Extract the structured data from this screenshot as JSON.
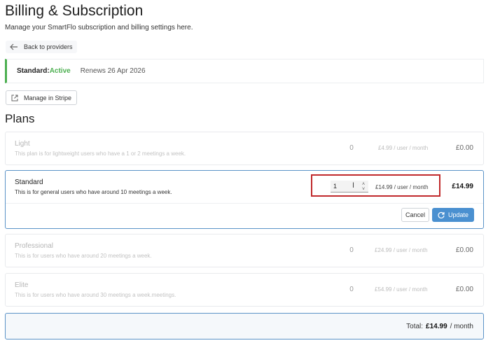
{
  "header": {
    "title": "Billing & Subscription",
    "subtitle": "Manage your SmartFlo subscription and billing settings here."
  },
  "back_button": {
    "label": "Back to providers",
    "icon": "arrow-left-icon"
  },
  "status": {
    "plan": "Standard",
    "separator": ":",
    "state": "Active",
    "renews": "Renews 26 Apr 2026",
    "accent_color": "#4caf50"
  },
  "manage_stripe": {
    "label": "Manage in Stripe",
    "icon": "external-link-icon"
  },
  "plans_section": {
    "title": "Plans"
  },
  "plans": [
    {
      "name": "Light",
      "description": "This plan is for lightweight users who have a 1 or 2 meetings a week.",
      "quantity": "0",
      "price": "£4.99 / user / month",
      "total": "£0.00"
    },
    {
      "name": "Standard",
      "description": "This is for general users who have around 10 meetings a week.",
      "quantity": "1",
      "price": "£14.99 / user / month",
      "total": "£14.99",
      "selected": true
    },
    {
      "name": "Professional",
      "description": "This is for users who have around 20 meetings a week.",
      "quantity": "0",
      "price": "£24.99 / user / month",
      "total": "£0.00"
    },
    {
      "name": "Elite",
      "description": "This is for users who have around 30 meetings a week.meetings.",
      "quantity": "0",
      "price": "£54.99 / user / month",
      "total": "£0.00"
    }
  ],
  "actions": {
    "cancel_label": "Cancel",
    "update_label": "Update"
  },
  "summary": {
    "label": "Total:",
    "amount": "£14.99",
    "period": "/ month"
  },
  "colors": {
    "primary": "#4a90d0",
    "highlight": "#c0292b",
    "selected_border": "#5b93c7"
  }
}
